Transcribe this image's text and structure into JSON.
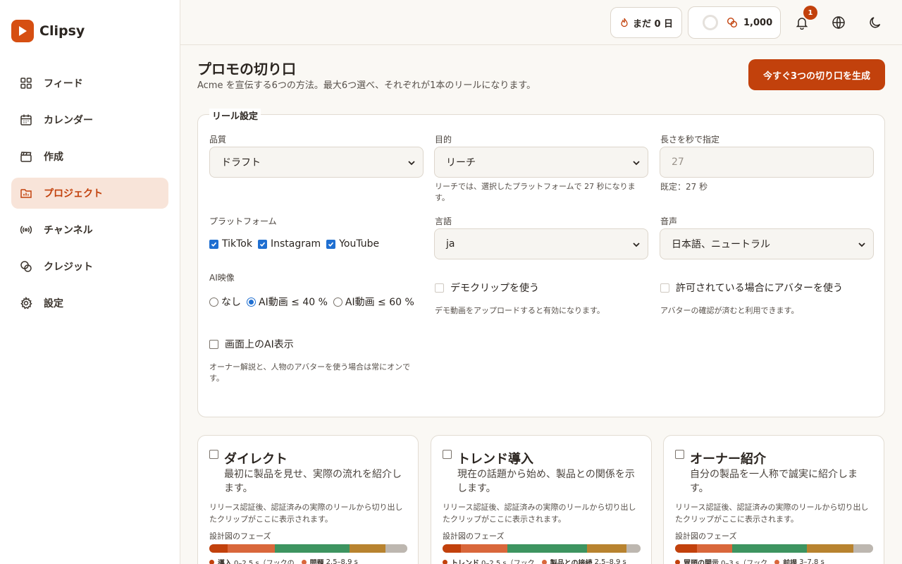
{
  "app": {
    "name": "Clipsy",
    "brand_color": "#c2410c"
  },
  "sidebar": {
    "items": [
      {
        "label": "フィード",
        "icon": "grid-icon"
      },
      {
        "label": "カレンダー",
        "icon": "calendar-icon"
      },
      {
        "label": "作成",
        "icon": "clapperboard-icon"
      },
      {
        "label": "プロジェクト",
        "icon": "folder-chart-icon",
        "active": true
      },
      {
        "label": "チャンネル",
        "icon": "broadcast-icon"
      },
      {
        "label": "クレジット",
        "icon": "coins-icon"
      },
      {
        "label": "設定",
        "icon": "gear-icon"
      }
    ]
  },
  "header": {
    "streak_label": "まだ 0 日",
    "credits": "1,000",
    "notification_count": "1"
  },
  "page": {
    "title": "プロモの切り口",
    "subtitle": "Acme を宣伝する6つの方法。最大6つ選べ、それぞれが1本のリールになります。",
    "generate_button": "今すぐ3つの切り口を生成"
  },
  "reel_settings": {
    "legend": "リール設定",
    "quality": {
      "label": "品質",
      "value": "ドラフト"
    },
    "purpose": {
      "label": "目的",
      "value": "リーチ",
      "note": "リーチでは、選択したプラットフォームで 27 秒になります。"
    },
    "length": {
      "label": "長さを秒で指定",
      "placeholder": "27",
      "note": "既定：27 秒"
    },
    "platforms": {
      "label": "プラットフォーム",
      "options": [
        {
          "label": "TikTok",
          "checked": true
        },
        {
          "label": "Instagram",
          "checked": true
        },
        {
          "label": "YouTube",
          "checked": true
        }
      ]
    },
    "language": {
      "label": "言語",
      "value": "ja"
    },
    "voice": {
      "label": "音声",
      "value": "日本語、ニュートラル"
    },
    "ai_video": {
      "label": "AI映像",
      "options": [
        {
          "label": "なし",
          "selected": false
        },
        {
          "label": "AI動画 ≤ 40 %",
          "selected": true
        },
        {
          "label": "AI動画 ≤ 60 %",
          "selected": false
        }
      ]
    },
    "demo_clip": {
      "label": "デモクリップを使う",
      "note": "デモ動画をアップロードすると有効になります。"
    },
    "avatar": {
      "label": "許可されている場合にアバターを使う",
      "note": "アバターの確認が済むと利用できます。"
    },
    "onscreen_ai": {
      "label": "画面上のAI表示",
      "note": "オーナー解説と、人物のアバターを使う場合は常にオンです。"
    }
  },
  "angles": [
    {
      "title": "ダイレクト",
      "desc": "最初に製品を見せ、実際の流れを紹介します。",
      "note": "リリース認証後、認証済みの実際のリールから切り出したクリップがここに表示されます。",
      "phase_label": "設計図のフェーズ",
      "phases": [
        {
          "color": "#c2410c",
          "share": 0.092
        },
        {
          "color": "#d9673b",
          "share": 0.238
        },
        {
          "color": "#3d9460",
          "share": 0.378
        },
        {
          "color": "#b8832f",
          "share": 0.18
        },
        {
          "color": "#bdb7b0",
          "share": 0.112
        }
      ],
      "legend": [
        {
          "name": "導入",
          "range": "0–2.5 s（フックの",
          "color": "#c2410c"
        },
        {
          "name": "問題",
          "range": "2.5–8.9 s",
          "color": "#d9673b"
        }
      ]
    },
    {
      "title": "トレンド導入",
      "desc": "現在の話題から始め、製品との関係を示します。",
      "note": "リリース認証後、認証済みの実際のリールから切り出したクリップがここに表示されます。",
      "phase_label": "設計図のフェーズ",
      "phases": [
        {
          "color": "#c2410c",
          "share": 0.092
        },
        {
          "color": "#d9673b",
          "share": 0.235
        },
        {
          "color": "#3d9460",
          "share": 0.403
        },
        {
          "color": "#b8832f",
          "share": 0.2
        },
        {
          "color": "#bdb7b0",
          "share": 0.07
        }
      ],
      "legend": [
        {
          "name": "トレンド",
          "range": "0–2.5 s（フック",
          "color": "#c2410c"
        },
        {
          "name": "製品との接続",
          "range": "2.5–8.9 s",
          "color": "#d9673b"
        }
      ]
    },
    {
      "title": "オーナー紹介",
      "desc": "自分の製品を一人称で誠実に紹介します。",
      "note": "リリース認証後、認証済みの実際のリールから切り出したクリップがここに表示されます。",
      "phase_label": "設計図のフェーズ",
      "phases": [
        {
          "color": "#c2410c",
          "share": 0.11
        },
        {
          "color": "#d9673b",
          "share": 0.18
        },
        {
          "color": "#3d9460",
          "share": 0.377
        },
        {
          "color": "#b8832f",
          "share": 0.233
        },
        {
          "color": "#bdb7b0",
          "share": 0.1
        }
      ],
      "legend": [
        {
          "name": "冒頭の開示",
          "range": "0–3 s（フック",
          "color": "#c2410c"
        },
        {
          "name": "前提",
          "range": "3–7.8 s",
          "color": "#d9673b"
        }
      ]
    }
  ]
}
